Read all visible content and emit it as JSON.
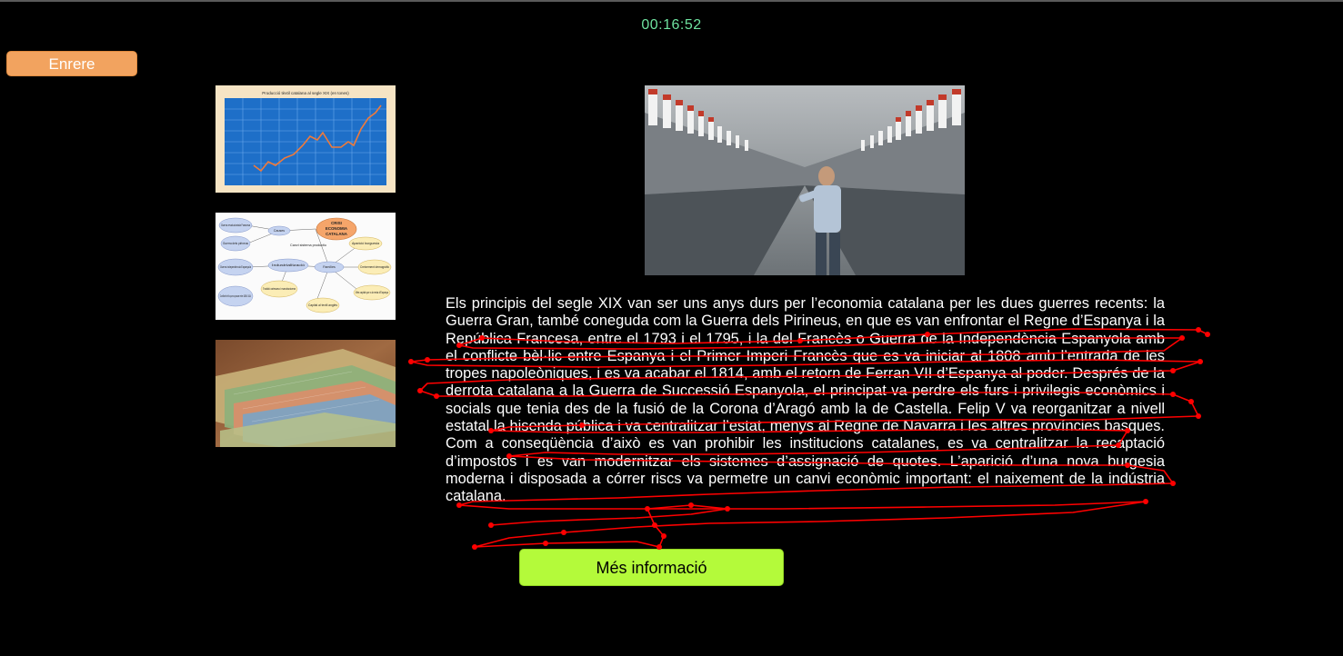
{
  "timer": "00:16:52",
  "back_button": {
    "label": "Enrere"
  },
  "thumbnails": [
    {
      "name": "textile-production-chart",
      "title": "Producció tèxtil catalana al segle XIX (en tones)"
    },
    {
      "name": "economic-crisis-diagram",
      "center": [
        "CRISI",
        "ECONOMIA",
        "CATALANA"
      ],
      "nodes": [
        "Causes",
        "Canvi sistema productiu",
        "Industrialització",
        "Famílies",
        "Aparició burguesia",
        "Creixement demogràfic",
        "Tradició artesana i manufacturera",
        "Capital al textil anglès",
        "Més capital que a la resta d'Espanya"
      ],
      "left_nodes": [
        "Guerra revolucionària Francesa",
        "Guerra dels pirineus",
        "Guerra independència Espanyola",
        "Conflicte bèl·lic que va passar entre 1808 i 1814"
      ]
    },
    {
      "name": "euro-banknotes-photo"
    }
  ],
  "main_image": {
    "name": "textile-factory-worker-photo"
  },
  "article": {
    "text": "Els principis del segle XIX van ser uns anys durs per l’economia catalana per les dues guerres recents: la Guerra Gran, també coneguda com la Guerra dels Pirineus, en que es van enfrontar el Regne d’Espanya i la República Francesa, entre el 1793 i el 1795, i la del Francès o Guerra de la Independència Espanyola amb el conflicte bèl·lic entre Espanya i el Primer Imperi Francès que es va iniciar al 1808 amb l’entrada de les tropes napoleòniques, i es va acabar el 1814, amb el retorn de Ferran VII d’Espanya al poder. Després de la derrota catalana a la Guerra de Successió Espanyola, el principat va perdre els furs i privilegis econòmics i socials que tenia des de la fusió de la Corona d’Aragó amb la de Castella. Felip V va reorganitzar a nivell estatal la hisenda pública i va centralitzar l’estat, menys al Regne de Navarra i les altres províncies basques. Com a conseqüència d’això es van prohibir les institucions catalanes, es va centralitzar la recaptació d’impostos i es van modernitzar els sistemes d’assignació de quotes. L’aparició d’una nova burgesia moderna i disposada a córrer riscs va permetre un canvi econòmic important: el naixement de la indústria catalana."
  },
  "more_button": {
    "label": "Més informació"
  },
  "colors": {
    "background": "#000000",
    "timer": "#6fe3a0",
    "back_button": "#f2a35f",
    "more_button": "#b4fa3a",
    "scribble": "#ff0000"
  }
}
